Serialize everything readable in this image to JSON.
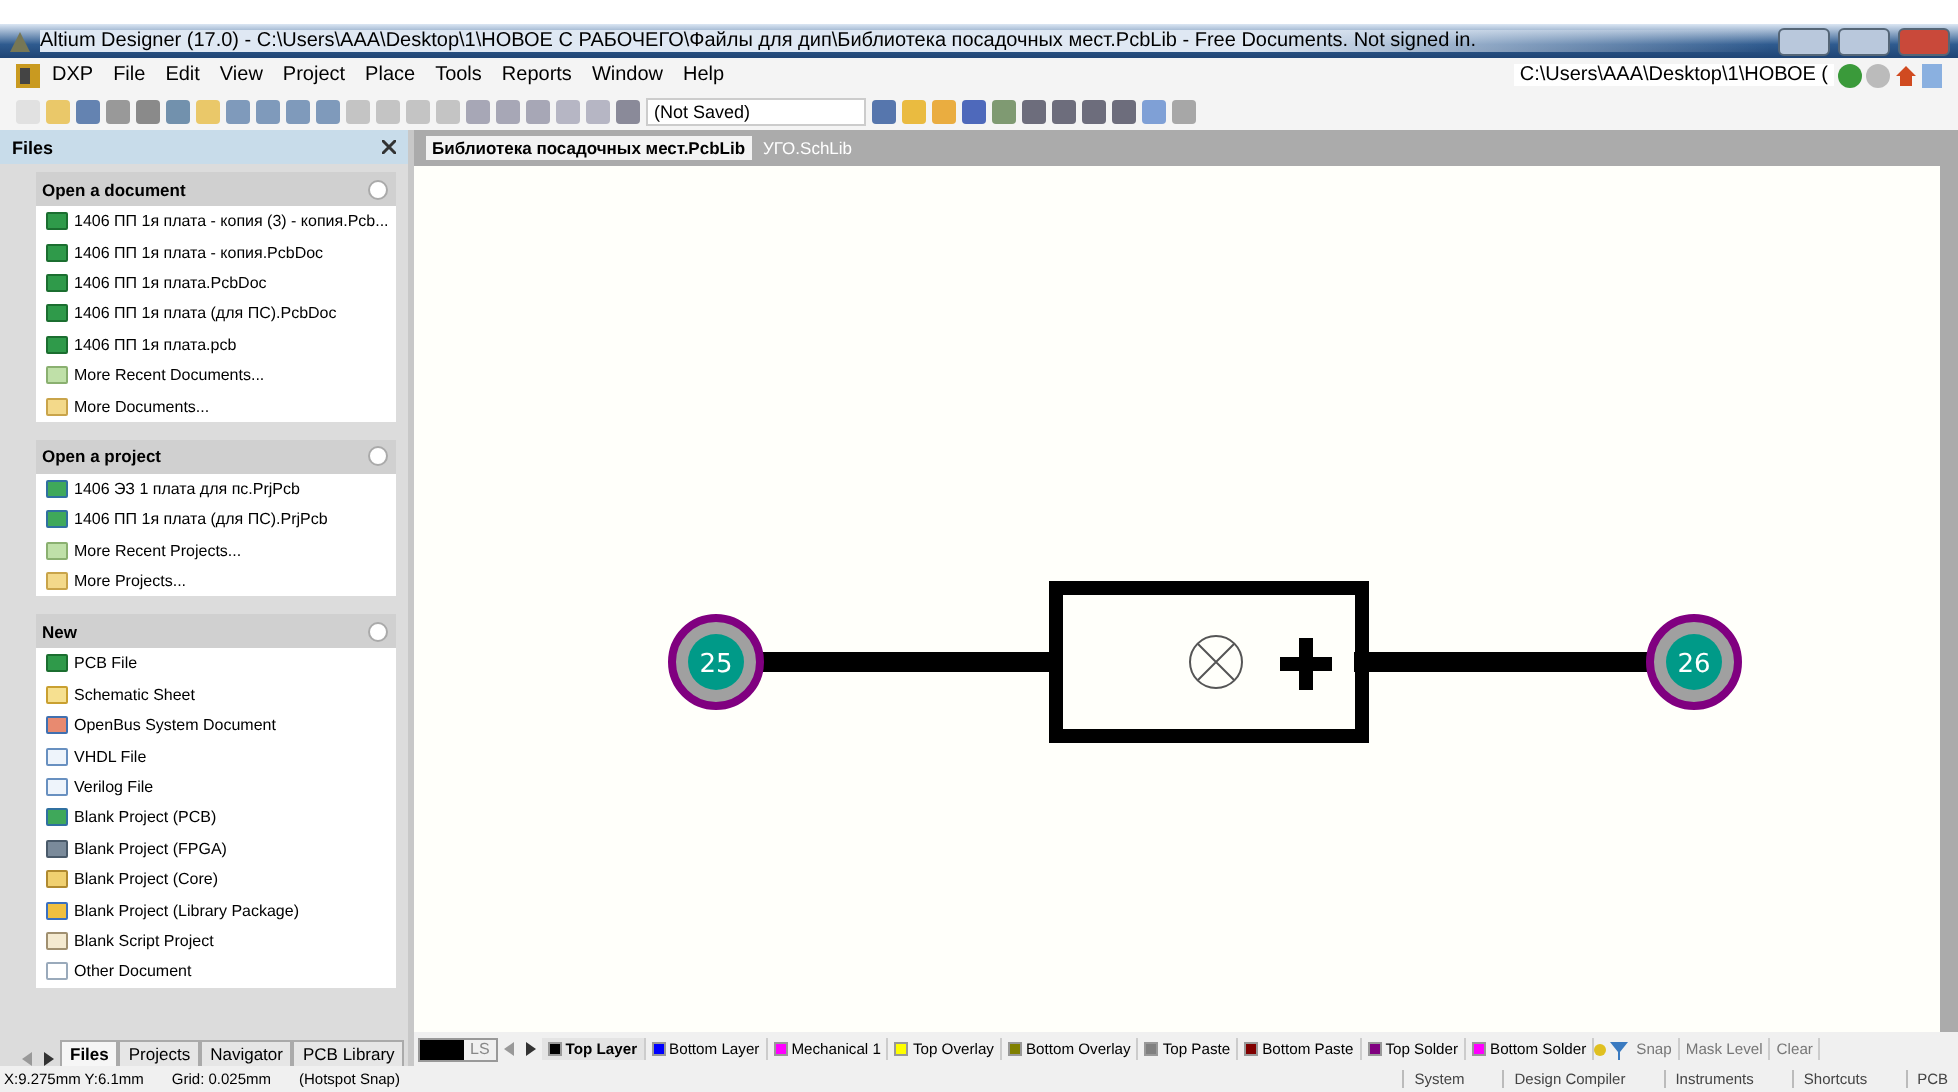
{
  "window": {
    "title": "Altium Designer (17.0) - C:\\Users\\AAA\\Desktop\\1\\НОВОЕ С РАБОЧЕГО\\Файлы для дип\\Библиотека посадочных мест.PcbLib - Free Documents. Not signed in."
  },
  "menu": [
    "DXP",
    "File",
    "Edit",
    "View",
    "Project",
    "Place",
    "Tools",
    "Reports",
    "Window",
    "Help"
  ],
  "address": "C:\\Users\\AAA\\Desktop\\1\\НОВОЕ (",
  "variant": "(Not Saved)",
  "panel": {
    "title": "Files",
    "sections": [
      {
        "title": "Open a document",
        "items": [
          {
            "label": "1406 ПП 1я плата - копия (3) - копия.Pcb...",
            "kind": "pcb"
          },
          {
            "label": "1406 ПП 1я плата - копия.PcbDoc",
            "kind": "pcb"
          },
          {
            "label": "1406 ПП 1я плата.PcbDoc",
            "kind": "pcb"
          },
          {
            "label": "1406 ПП 1я плата (для ПС).PcbDoc",
            "kind": "pcb"
          },
          {
            "label": "1406 ПП 1я плата.pcb",
            "kind": "pcb"
          },
          {
            "label": "More Recent Documents...",
            "kind": "folder"
          },
          {
            "label": "More Documents...",
            "kind": "open-folder"
          }
        ]
      },
      {
        "title": "Open a project",
        "items": [
          {
            "label": "1406 ЭЗ 1 плата для пс.PrjPcb",
            "kind": "project"
          },
          {
            "label": "1406 ПП 1я плата (для ПС).PrjPcb",
            "kind": "project"
          },
          {
            "label": "More Recent Projects...",
            "kind": "folder"
          },
          {
            "label": "More Projects...",
            "kind": "open-folder"
          }
        ]
      },
      {
        "title": "New",
        "items": [
          {
            "label": "PCB File",
            "kind": "pcb"
          },
          {
            "label": "Schematic Sheet",
            "kind": "sheet"
          },
          {
            "label": "OpenBus System Document",
            "kind": "bus"
          },
          {
            "label": "VHDL File",
            "kind": "code"
          },
          {
            "label": "Verilog File",
            "kind": "code"
          },
          {
            "label": "Blank Project (PCB)",
            "kind": "project"
          },
          {
            "label": "Blank Project (FPGA)",
            "kind": "chip"
          },
          {
            "label": "Blank Project (Core)",
            "kind": "core"
          },
          {
            "label": "Blank Project (Library Package)",
            "kind": "package"
          },
          {
            "label": "Blank Script Project",
            "kind": "script"
          },
          {
            "label": "Other Document",
            "kind": "doc"
          }
        ]
      }
    ]
  },
  "panel_tabs": [
    {
      "label": "Files",
      "selected": true
    },
    {
      "label": "Projects",
      "selected": false
    },
    {
      "label": "Navigator",
      "selected": false
    },
    {
      "label": "PCB Library",
      "selected": false
    }
  ],
  "doc_tabs": [
    {
      "label": "Библиотека посадочных мест.PcbLib",
      "selected": true
    },
    {
      "label": "УГО.SchLib",
      "selected": false
    }
  ],
  "pads": [
    "25",
    "26"
  ],
  "layer_swatch": "LS",
  "layers": [
    {
      "label": "Top Layer",
      "color": "#000000",
      "selected": true
    },
    {
      "label": "Bottom Layer",
      "color": "#0000ff",
      "selected": false
    },
    {
      "label": "Mechanical 1",
      "color": "#ff00ff",
      "selected": false
    },
    {
      "label": "Top Overlay",
      "color": "#ffff00",
      "selected": false
    },
    {
      "label": "Bottom Overlay",
      "color": "#808000",
      "selected": false
    },
    {
      "label": "Top Paste",
      "color": "#808080",
      "selected": false
    },
    {
      "label": "Bottom Paste",
      "color": "#800000",
      "selected": false
    },
    {
      "label": "Top Solder",
      "color": "#800080",
      "selected": false
    },
    {
      "label": "Bottom Solder",
      "color": "#ff00ff",
      "selected": false
    }
  ],
  "layer_buttons": [
    "Snap",
    "Mask Level",
    "Clear"
  ],
  "status": {
    "coords": "X:9.275mm Y:6.1mm",
    "grid": "Grid: 0.025mm",
    "snap": "(Hotspot Snap)",
    "buttons": [
      "System",
      "Design Compiler",
      "Instruments",
      "Shortcuts",
      "PCB"
    ]
  }
}
